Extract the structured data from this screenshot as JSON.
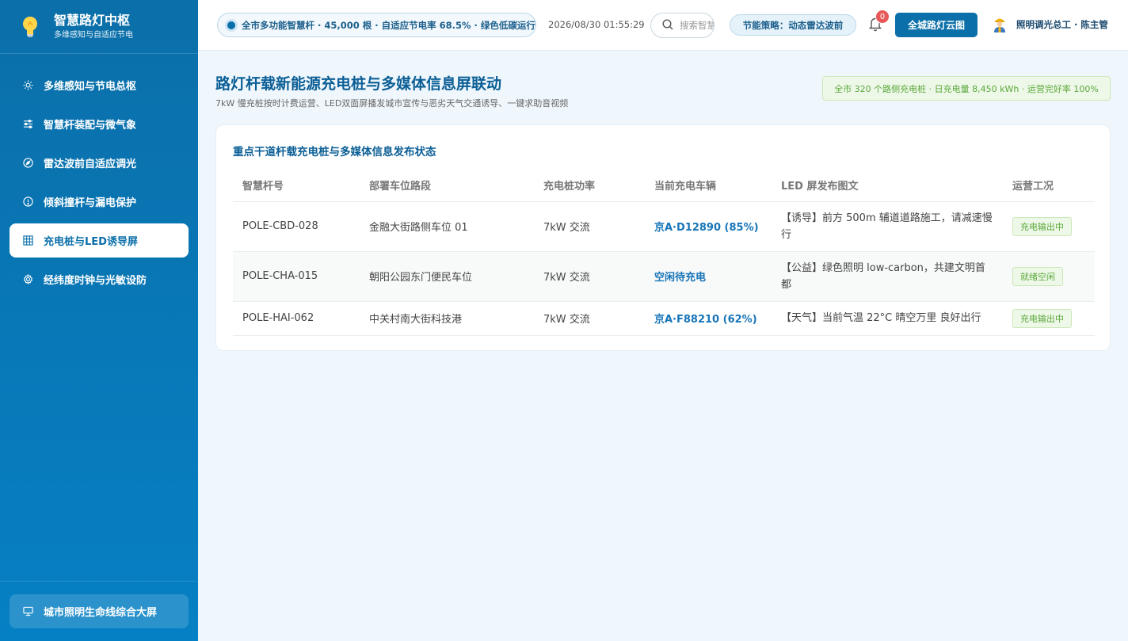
{
  "sidebar": {
    "brand_title": "智慧路灯中枢",
    "brand_subtitle": "多维感知与自适应节电",
    "items": [
      {
        "label": "多维感知与节电总枢",
        "icon": "sun-icon"
      },
      {
        "label": "智慧杆装配与微气象",
        "icon": "sliders-icon"
      },
      {
        "label": "雷达波前自适应调光",
        "icon": "compass-icon"
      },
      {
        "label": "倾斜撞杆与漏电保护",
        "icon": "alert-circle-icon"
      },
      {
        "label": "充电桩与LED诱导屏",
        "icon": "grid-icon"
      },
      {
        "label": "经纬度时钟与光敏设防",
        "icon": "gear-icon"
      }
    ],
    "active_index": 4,
    "bottom_button": "城市照明生命线综合大屏"
  },
  "header": {
    "status": "全市多功能智慧杆 · 45,000 根 · 自适应节电率 68.5% · 绿色低碳运行",
    "datetime": "2026/08/30 01:55:29",
    "search_placeholder": "搜索智慧杆",
    "strategy": "节能策略：动态雷达波前",
    "notification_count": "0",
    "cloud_button": "全城路灯云图",
    "user": "照明调光总工 · 陈主管"
  },
  "main": {
    "title": "路灯杆载新能源充电桩与多媒体信息屏联动",
    "subtitle": "7kW 慢充桩按时计费运营、LED双面屏播发城市宣传与恶劣天气交通诱导、一键求助音视频",
    "summary": "全市 320 个路侧充电桩 · 日充电量 8,450 kWh · 运营完好率 100%"
  },
  "card": {
    "title": "重点干道杆载充电桩与多媒体信息发布状态",
    "columns": [
      "智慧杆号",
      "部署车位路段",
      "充电桩功率",
      "当前充电车辆",
      "LED 屏发布图文",
      "运营工况"
    ],
    "rows": [
      {
        "pole": "POLE-CBD-028",
        "location": "金融大街路侧车位 01",
        "power": "7kW 交流",
        "vehicle": "京A·D12890 (85%)",
        "led": "【诱导】前方 500m 辅道道路施工，请减速慢行",
        "status": "充电输出中"
      },
      {
        "pole": "POLE-CHA-015",
        "location": "朝阳公园东门便民车位",
        "power": "7kW 交流",
        "vehicle": "空闲待充电",
        "led": "【公益】绿色照明 low-carbon，共建文明首都",
        "status": "就绪空闲"
      },
      {
        "pole": "POLE-HAI-062",
        "location": "中关村南大街科技港",
        "power": "7kW 交流",
        "vehicle": "京A·F88210 (62%)",
        "led": "【天气】当前气温 22°C 晴空万里 良好出行",
        "status": "充电输出中"
      }
    ]
  },
  "colors": {
    "primary": "#0b6fa9",
    "accent_green": "#5aa83b",
    "badge_red": "#e85858"
  }
}
